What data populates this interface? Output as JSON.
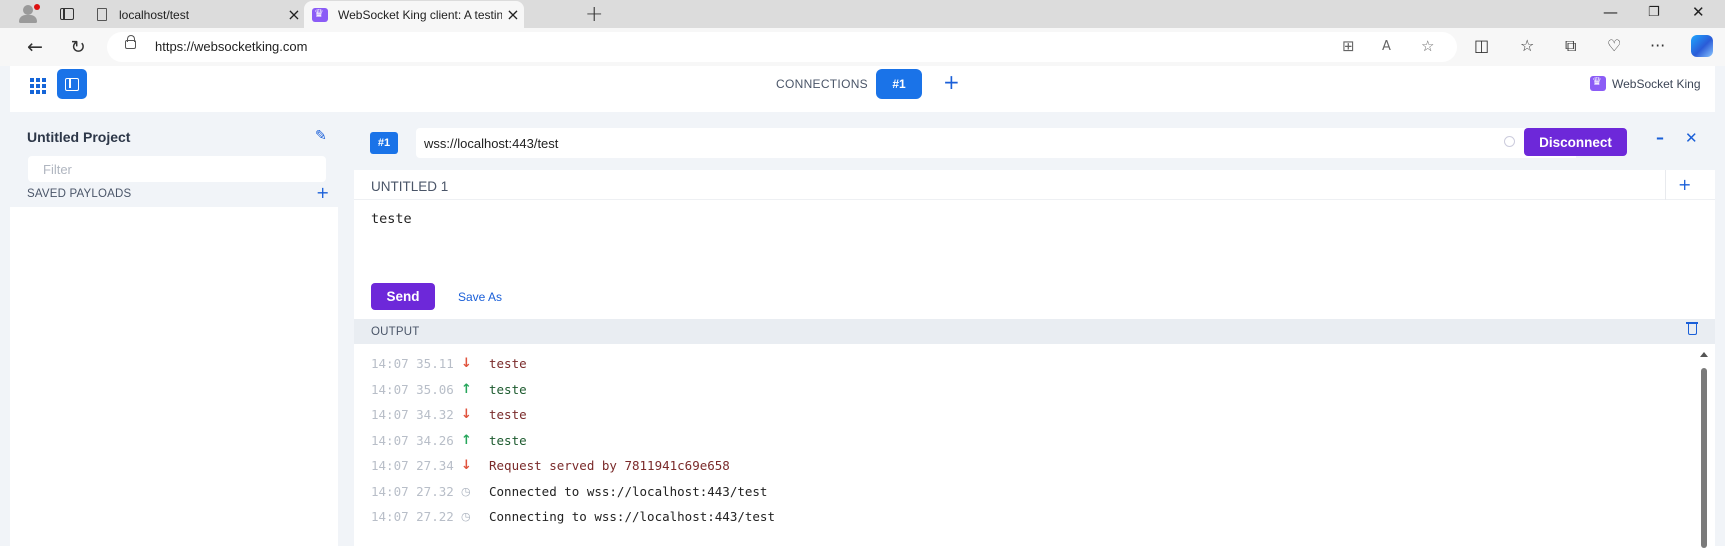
{
  "browser": {
    "tabs": [
      {
        "title": "localhost/test",
        "active": false
      },
      {
        "title": "WebSocket King client: A testing",
        "active": true
      }
    ],
    "address": "https://websocketking.com",
    "window_controls": [
      "—",
      "❐",
      "✕"
    ]
  },
  "app": {
    "connections_label": "CONNECTIONS",
    "active_connection": "#1",
    "brand": "WebSocket King",
    "sidebar": {
      "project_title": "Untitled Project",
      "filter_placeholder": "Filter",
      "saved_payloads_label": "SAVED PAYLOADS"
    },
    "connection": {
      "badge": "#1",
      "url": "wss://localhost:443/test",
      "disconnect_label": "Disconnect"
    },
    "message": {
      "title": "UNTITLED 1",
      "body": "teste",
      "send_label": "Send",
      "save_as_label": "Save As"
    },
    "output": {
      "title": "OUTPUT",
      "logs": [
        {
          "time": "14:07 35.11",
          "direction": "in",
          "text": "teste"
        },
        {
          "time": "14:07 35.06",
          "direction": "out",
          "text": "teste"
        },
        {
          "time": "14:07 34.32",
          "direction": "in",
          "text": "teste"
        },
        {
          "time": "14:07 34.26",
          "direction": "out",
          "text": "teste"
        },
        {
          "time": "14:07 27.34",
          "direction": "in",
          "text": "Request served by 7811941c69e658"
        },
        {
          "time": "14:07 27.32",
          "direction": "info",
          "text": "Connected to wss://localhost:443/test"
        },
        {
          "time": "14:07 27.22",
          "direction": "info",
          "text": "Connecting to wss://localhost:443/test"
        }
      ]
    },
    "colors": {
      "primary": "#1a73e8",
      "accent": "#6d28d9",
      "incoming": "#e0533d",
      "outgoing": "#26a65b"
    }
  }
}
